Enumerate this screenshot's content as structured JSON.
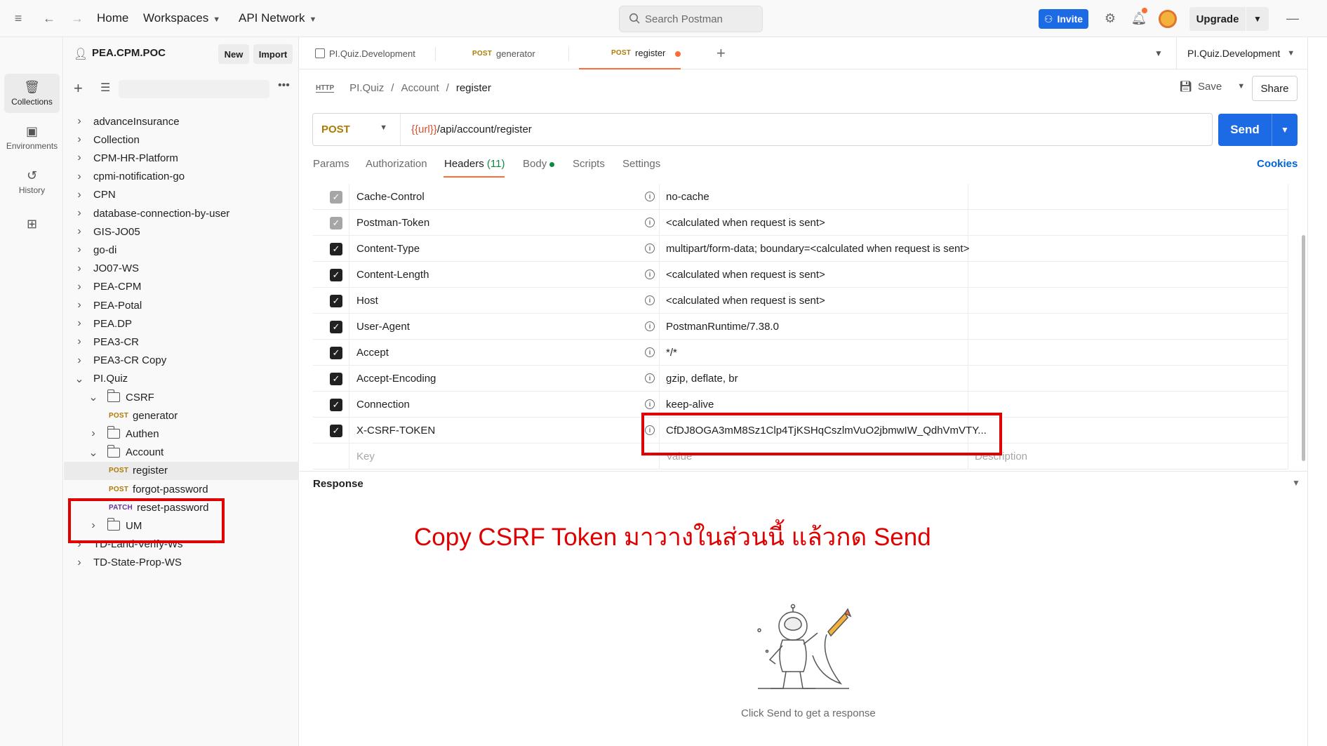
{
  "topbar": {
    "home": "Home",
    "workspaces": "Workspaces",
    "api_network": "API Network",
    "search_placeholder": "Search Postman",
    "invite": "Invite",
    "upgrade": "Upgrade"
  },
  "rail": {
    "collections": "Collections",
    "environments": "Environments",
    "history": "History"
  },
  "sidebar": {
    "workspace": "PEA.CPM.POC",
    "new_btn": "New",
    "import_btn": "Import",
    "items": [
      {
        "label": "advanceInsurance",
        "type": "collection"
      },
      {
        "label": "Collection",
        "type": "collection"
      },
      {
        "label": "CPM-HR-Platform",
        "type": "collection"
      },
      {
        "label": "cpmi-notification-go",
        "type": "collection"
      },
      {
        "label": "CPN",
        "type": "collection"
      },
      {
        "label": "database-connection-by-user",
        "type": "collection"
      },
      {
        "label": "GIS-JO05",
        "type": "collection"
      },
      {
        "label": "go-di",
        "type": "collection"
      },
      {
        "label": "JO07-WS",
        "type": "collection"
      },
      {
        "label": "PEA-CPM",
        "type": "collection"
      },
      {
        "label": "PEA-Potal",
        "type": "collection"
      },
      {
        "label": "PEA.DP",
        "type": "collection"
      },
      {
        "label": "PEA3-CR",
        "type": "collection"
      },
      {
        "label": "PEA3-CR Copy",
        "type": "collection"
      },
      {
        "label": "PI.Quiz",
        "type": "collection-open"
      },
      {
        "label": "CSRF",
        "type": "folder-open"
      },
      {
        "label": "generator",
        "method": "POST",
        "type": "request"
      },
      {
        "label": "Authen",
        "type": "folder"
      },
      {
        "label": "Account",
        "type": "folder-open"
      },
      {
        "label": "register",
        "method": "POST",
        "type": "request-selected"
      },
      {
        "label": "forgot-password",
        "method": "POST",
        "type": "request"
      },
      {
        "label": "reset-password",
        "method": "PATCH",
        "type": "request"
      },
      {
        "label": "UM",
        "type": "folder"
      },
      {
        "label": "TD-Land-Verify-Ws",
        "type": "collection"
      },
      {
        "label": "TD-State-Prop-WS",
        "type": "collection"
      }
    ]
  },
  "tabs": [
    {
      "label": "PI.Quiz.Development",
      "method": ""
    },
    {
      "label": "generator",
      "method": "POST"
    },
    {
      "label": "register",
      "method": "POST",
      "active": true
    }
  ],
  "environment": "PI.Quiz.Development",
  "request": {
    "breadcrumb": [
      "PI.Quiz",
      "Account",
      "register"
    ],
    "save": "Save",
    "share": "Share",
    "method": "POST",
    "url_var": "{{url}}",
    "url_path": "/api/account/register",
    "send": "Send",
    "tabs": [
      "Params",
      "Authorization",
      "Headers",
      "Body",
      "Scripts",
      "Settings"
    ],
    "headers_count": "(11)",
    "cookies": "Cookies"
  },
  "headers": [
    {
      "key": "Cache-Control",
      "value": "no-cache",
      "disabled": true
    },
    {
      "key": "Postman-Token",
      "value": "<calculated when request is sent>",
      "disabled": true
    },
    {
      "key": "Content-Type",
      "value": "multipart/form-data; boundary=<calculated when request is sent>",
      "disabled": false
    },
    {
      "key": "Content-Length",
      "value": "<calculated when request is sent>",
      "disabled": false
    },
    {
      "key": "Host",
      "value": "<calculated when request is sent>",
      "disabled": false
    },
    {
      "key": "User-Agent",
      "value": "PostmanRuntime/7.38.0",
      "disabled": false
    },
    {
      "key": "Accept",
      "value": "*/*",
      "disabled": false
    },
    {
      "key": "Accept-Encoding",
      "value": "gzip, deflate, br",
      "disabled": false
    },
    {
      "key": "Connection",
      "value": "keep-alive",
      "disabled": false
    },
    {
      "key": "X-CSRF-TOKEN",
      "value": "CfDJ8OGA3mM8Sz1Clp4TjKSHqCszlmVuO2jbmwIW_QdhVmVTY...",
      "disabled": false
    }
  ],
  "headers_placeholder": {
    "key": "Key",
    "value": "Value",
    "description": "Description"
  },
  "response": {
    "title": "Response",
    "empty_text": "Click Send to get a response"
  },
  "annotation": "Copy CSRF Token มาวางในส่วนนี้ แล้วกด Send",
  "colors": {
    "accent": "#ff6c37",
    "send_blue": "#1d6ae5",
    "highlight_red": "#e00000"
  }
}
